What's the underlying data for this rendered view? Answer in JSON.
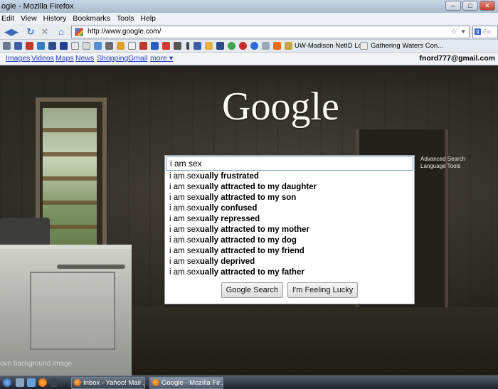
{
  "window": {
    "title": "ogle - Mozilla Firefox"
  },
  "menu": [
    "Edit",
    "View",
    "History",
    "Bookmarks",
    "Tools",
    "Help"
  ],
  "nav": {
    "url": "http://www.google.com/",
    "search_engine_hint": "Go"
  },
  "bookmarks": {
    "items": [
      "UW-Madison NetID Lo...",
      "Gathering Waters Con..."
    ]
  },
  "gbar": {
    "links": [
      "Images",
      "Videos",
      "Maps",
      "News",
      "Shopping",
      "Gmail",
      "more ▾"
    ],
    "user": "fnord777@gmail.com"
  },
  "logo": "Google",
  "search": {
    "query": "i am sex",
    "typed_part": "i am sex",
    "suggestions": [
      {
        "typed": "i am sex",
        "completion": "ually frustrated"
      },
      {
        "typed": "i am sex",
        "completion": "ually attracted to my daughter"
      },
      {
        "typed": "i am sex",
        "completion": "ually attracted to my son"
      },
      {
        "typed": "i am sex",
        "completion": "ually confused"
      },
      {
        "typed": "i am sex",
        "completion": "ually repressed"
      },
      {
        "typed": "i am sex",
        "completion": "ually attracted to my mother"
      },
      {
        "typed": "i am sex",
        "completion": "ually attracted to my dog"
      },
      {
        "typed": "i am sex",
        "completion": "ually attracted to my friend"
      },
      {
        "typed": "i am sex",
        "completion": "ually deprived"
      },
      {
        "typed": "i am sex",
        "completion": "ually attracted to my father"
      }
    ],
    "google_search_label": "Google Search",
    "lucky_label": "I'm Feeling Lucky"
  },
  "side_links": [
    "Advanced Search",
    "Language Tools"
  ],
  "bottom_link": "ove background image",
  "taskbar": {
    "items": [
      "Inbox - Yahoo! Mail ...",
      "Google - Mozilla Fir..."
    ]
  }
}
